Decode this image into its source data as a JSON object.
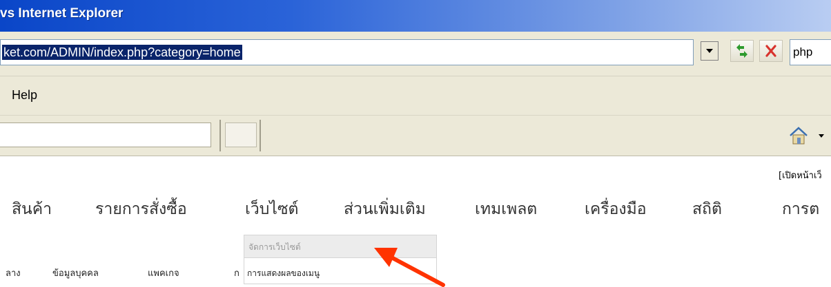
{
  "window": {
    "title": "vs Internet Explorer"
  },
  "address_bar": {
    "url": "ket.com/ADMIN/index.php?category=home"
  },
  "search": {
    "value": "php"
  },
  "menu": {
    "help": "Help"
  },
  "page": {
    "open_site_link": "[เปิดหน้าเว็",
    "nav_items": [
      "สินค้า",
      "รายการสั่งซื้อ",
      "เว็บไซต์",
      "ส่วนเพิ่มเติม",
      "เทมเพลต",
      "เครื่องมือ",
      "สถิติ",
      "การต"
    ],
    "sub_items": [
      "ลาง",
      "ข้อมูลบุคคล",
      "แพคเกจ",
      "ก"
    ],
    "dropdown": [
      "จัดการเว็บไซต์",
      "การแสดงผลของเมนู"
    ]
  },
  "colors": {
    "titlebar": "#0a46c8",
    "selection": "#0a246a",
    "annotation_arrow": "#ff3300"
  },
  "icons": [
    "refresh-icon",
    "stop-icon",
    "home-icon",
    "dropdown-arrow-icon",
    "annotation-arrow"
  ]
}
